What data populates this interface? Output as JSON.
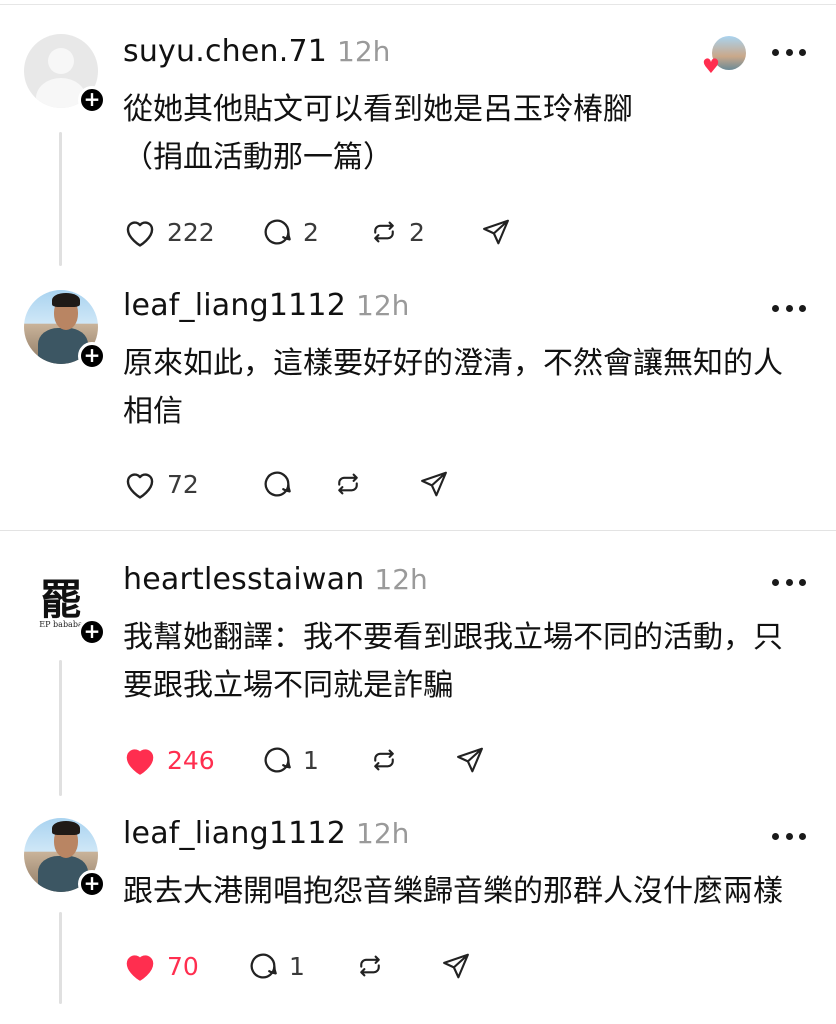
{
  "posts": [
    {
      "username": "suyu.chen.71",
      "time": "12h",
      "lines": [
        "從她其他貼文可以看到她是呂玉玲椿腳",
        "（捐血活動那一篇）"
      ],
      "likes": "222",
      "liked": false,
      "replies": "2",
      "reposts": "2"
    },
    {
      "username": "leaf_liang1112",
      "time": "12h",
      "lines": [
        "原來如此，這樣要好好的澄清，不然會讓無知的人",
        "相信"
      ],
      "likes": "72",
      "liked": false,
      "replies": "",
      "reposts": ""
    },
    {
      "username": "heartlesstaiwan",
      "time": "12h",
      "logo_text": "罷",
      "logo_small": "EP bababa",
      "lines": [
        "我幫她翻譯：我不要看到跟我立場不同的活動，只",
        "要跟我立場不同就是詐騙"
      ],
      "likes": "246",
      "liked": true,
      "replies": "1",
      "reposts": ""
    },
    {
      "username": "leaf_liang1112",
      "time": "12h",
      "lines": [
        "跟去大港開唱抱怨音樂歸音樂的那群人沒什麼兩樣"
      ],
      "likes": "70",
      "liked": true,
      "replies": "1",
      "reposts": ""
    }
  ],
  "icons": {
    "like": "heart-icon",
    "reply": "comment-icon",
    "repost": "repost-icon",
    "share": "send-icon",
    "more": "more-icon",
    "follow": "plus-icon"
  },
  "colors": {
    "liked": "#ff2e4f",
    "text": "#111111",
    "muted": "#9a9a9a",
    "divider": "#e3e3e3"
  }
}
